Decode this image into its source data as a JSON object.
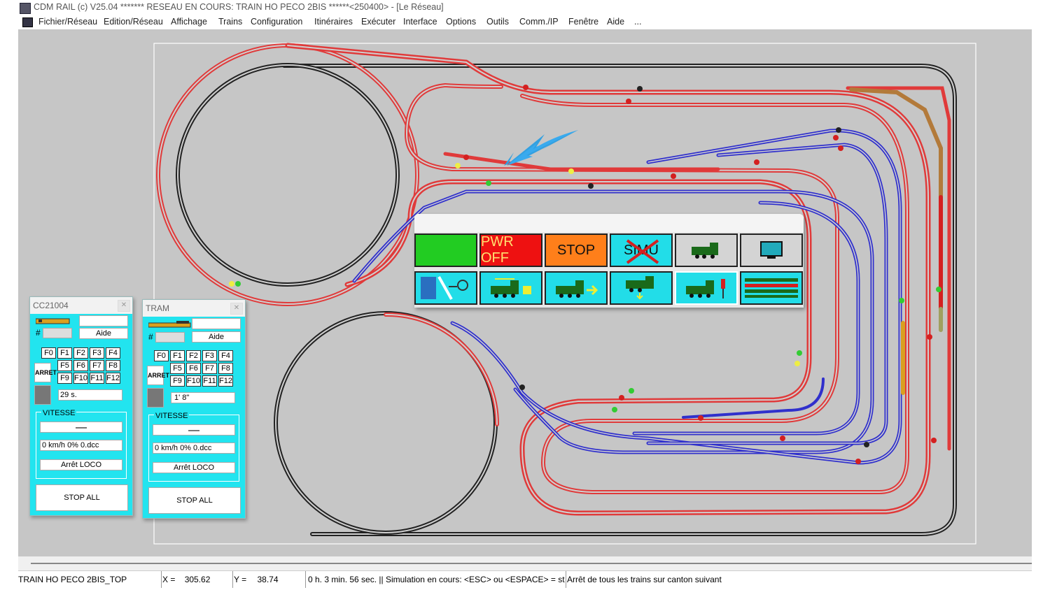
{
  "window": {
    "title": "CDM RAIL (c) V25.04        ******* RESEAU EN COURS: TRAIN HO PECO 2BIS ******<250400> - [Le Réseau]"
  },
  "menu": [
    "Fichier/Réseau",
    "Edition/Réseau",
    "Affichage",
    "Trains",
    "Configuration",
    "Itinéraires",
    "Exécuter",
    "Interface",
    "Options",
    "Outils",
    "Comm./IP",
    "Fenêtre",
    "Aide",
    "..."
  ],
  "control_panel": {
    "row1": [
      {
        "label": "",
        "color": "#22cc22",
        "icon": "power-on-icon"
      },
      {
        "label": "PWR OFF",
        "color": "#ee1111",
        "icon": ""
      },
      {
        "label": "STOP",
        "color": "#ff7f1a",
        "icon": ""
      },
      {
        "label": "SIMU",
        "color": "#22dde8",
        "icon": "simulation-crossed-icon"
      },
      {
        "label": "",
        "color": "#d4d4d4",
        "icon": "locomotive-icon"
      },
      {
        "label": "",
        "color": "#d4d4d4",
        "icon": "monitor-icon"
      }
    ],
    "row2_icons": [
      "track-switch-key-icon",
      "loco-lock-icon",
      "loco-arrow-icon",
      "loco-down-icon",
      "loco-signal-icon",
      "train-list-icon"
    ],
    "row2_color": "#22dde8"
  },
  "loco_windows": [
    {
      "name": "CC21004",
      "aide": "Aide",
      "hash": "#",
      "timer": "29 s.",
      "stop_label": "ARRET",
      "vitesse": "VITESSE",
      "speed": "0 km/h 0% 0.dcc",
      "arret_loco": "Arrêt LOCO",
      "stop_all": "STOP ALL",
      "fkeys": [
        "F0",
        "F1",
        "F2",
        "F3",
        "F4",
        "F5",
        "F6",
        "F7",
        "F8",
        "F9",
        "F10",
        "F11",
        "F12"
      ]
    },
    {
      "name": "TRAM",
      "aide": "Aide",
      "hash": "#",
      "timer": "1' 8\"",
      "stop_label": "ARRET",
      "vitesse": "VITESSE",
      "speed": "0 km/h 0% 0.dcc",
      "arret_loco": "Arrêt LOCO",
      "stop_all": "STOP ALL",
      "fkeys": [
        "F0",
        "F1",
        "F2",
        "F3",
        "F4",
        "F5",
        "F6",
        "F7",
        "F8",
        "F9",
        "F10",
        "F11",
        "F12"
      ]
    }
  ],
  "status": {
    "network": "TRAIN HO PECO 2BIS_TOP",
    "x_label": "X =",
    "x_value": "305.62",
    "y_label": "Y =",
    "y_value": "38.74",
    "message": "0 h. 3 min. 56 sec.  || Simulation en cours: <ESC> ou <ESPACE> = st",
    "message2": "Arrêt de tous les trains sur canton suivant"
  },
  "colors": {
    "track_red": "#e03a3a",
    "track_blue": "#3030cc",
    "track_black": "#222222",
    "canvas": "#c6c6c6",
    "loco_bg": "#22e4ef"
  }
}
